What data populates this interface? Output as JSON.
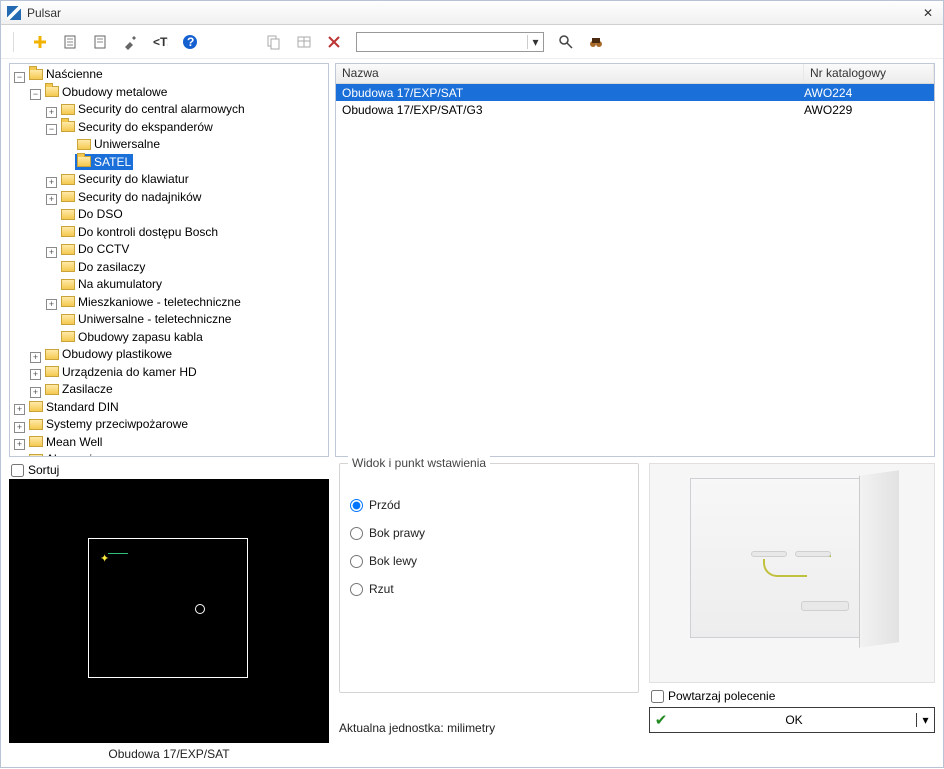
{
  "window": {
    "title": "Pulsar"
  },
  "toolbar": {
    "icons": [
      "add",
      "doc1",
      "doc2",
      "tools",
      "tag",
      "help",
      "copy",
      "paste-table",
      "delete",
      "search",
      "binoculars"
    ]
  },
  "tree": {
    "root": [
      {
        "label": "Naścienne",
        "open": true,
        "children": [
          {
            "label": "Obudowy metalowe",
            "open": true,
            "children": [
              {
                "label": "Security do central alarmowych",
                "expandable": true
              },
              {
                "label": "Security do ekspanderów",
                "open": true,
                "children": [
                  {
                    "label": "Uniwersalne"
                  },
                  {
                    "label": "SATEL",
                    "selected": true,
                    "openFolder": true
                  }
                ]
              },
              {
                "label": "Security do klawiatur",
                "expandable": true
              },
              {
                "label": "Security do nadajników",
                "expandable": true
              },
              {
                "label": "Do DSO"
              },
              {
                "label": "Do kontroli dostępu Bosch"
              },
              {
                "label": "Do CCTV",
                "expandable": true
              },
              {
                "label": "Do zasilaczy"
              },
              {
                "label": "Na akumulatory"
              },
              {
                "label": "Mieszkaniowe - teletechniczne",
                "expandable": true
              },
              {
                "label": "Uniwersalne - teletechniczne"
              },
              {
                "label": "Obudowy zapasu kabla"
              }
            ]
          },
          {
            "label": "Obudowy plastikowe",
            "expandable": true
          },
          {
            "label": "Urządzenia do kamer HD",
            "expandable": true
          },
          {
            "label": "Zasilacze",
            "expandable": true
          }
        ]
      },
      {
        "label": "Standard DIN",
        "expandable": true
      },
      {
        "label": "Systemy przeciwpożarowe",
        "expandable": true
      },
      {
        "label": "Mean Well",
        "expandable": true
      },
      {
        "label": "Akcesoria",
        "expandable": true
      }
    ]
  },
  "list": {
    "headers": {
      "name": "Nazwa",
      "catalog": "Nr katalogowy"
    },
    "rows": [
      {
        "name": "Obudowa 17/EXP/SAT",
        "catalog": "AWO224",
        "selected": true
      },
      {
        "name": "Obudowa 17/EXP/SAT/G3",
        "catalog": "AWO229"
      }
    ]
  },
  "sort": {
    "label": "Sortuj"
  },
  "preview": {
    "label": "Obudowa 17/EXP/SAT"
  },
  "insert": {
    "group_title": "Widok i punkt wstawienia",
    "options": [
      {
        "label": "Przód",
        "checked": true
      },
      {
        "label": "Bok prawy"
      },
      {
        "label": "Bok lewy"
      },
      {
        "label": "Rzut"
      }
    ],
    "unit_line": "Aktualna jednostka: milimetry"
  },
  "repeat": {
    "label": "Powtarzaj polecenie"
  },
  "ok": {
    "label": "OK"
  }
}
